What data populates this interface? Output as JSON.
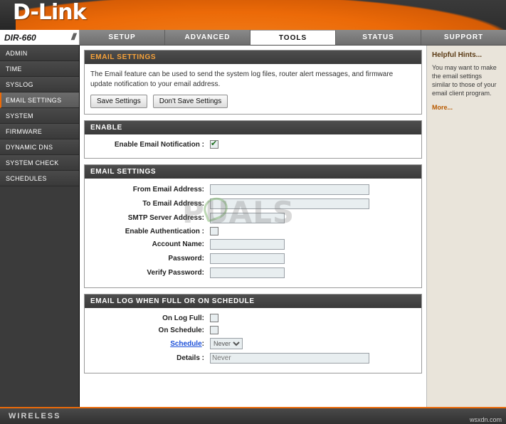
{
  "brand": {
    "logo": "D-Link",
    "footer": "WIRELESS",
    "credit": "wsxdn.com"
  },
  "nav": {
    "model": "DIR-660",
    "tabs": [
      {
        "label": "SETUP",
        "active": false
      },
      {
        "label": "ADVANCED",
        "active": false
      },
      {
        "label": "TOOLS",
        "active": true
      },
      {
        "label": "STATUS",
        "active": false
      },
      {
        "label": "SUPPORT",
        "active": false
      }
    ]
  },
  "sidebar": {
    "items": [
      {
        "label": "ADMIN",
        "active": false
      },
      {
        "label": "TIME",
        "active": false
      },
      {
        "label": "SYSLOG",
        "active": false
      },
      {
        "label": "EMAIL SETTINGS",
        "active": true
      },
      {
        "label": "SYSTEM",
        "active": false
      },
      {
        "label": "FIRMWARE",
        "active": false
      },
      {
        "label": "DYNAMIC DNS",
        "active": false
      },
      {
        "label": "SYSTEM CHECK",
        "active": false
      },
      {
        "label": "SCHEDULES",
        "active": false
      }
    ]
  },
  "main": {
    "intro_panel": {
      "title": "EMAIL SETTINGS",
      "description": "The Email feature can be used to send the system log files, router alert messages, and firmware update notification to your email address.",
      "save_label": "Save Settings",
      "dont_save_label": "Don't Save Settings"
    },
    "enable_panel": {
      "title": "ENABLE",
      "notification_label": "Enable Email Notification :",
      "notification_checked": true
    },
    "email_panel": {
      "title": "EMAIL SETTINGS",
      "from_label": "From Email Address:",
      "from_value": "",
      "to_label": "To Email Address:",
      "to_value": "",
      "smtp_label": "SMTP Server Address:",
      "smtp_value": "",
      "auth_label": "Enable Authentication :",
      "auth_checked": false,
      "account_label": "Account Name:",
      "account_value": "",
      "password_label": "Password:",
      "password_value": "",
      "verify_label": "Verify Password:",
      "verify_value": ""
    },
    "log_panel": {
      "title": "EMAIL LOG WHEN FULL OR ON SCHEDULE",
      "on_log_full_label": "On Log Full:",
      "on_log_full_checked": false,
      "on_schedule_label": "On Schedule:",
      "on_schedule_checked": false,
      "schedule_label": "Schedule",
      "schedule_colon": ":",
      "schedule_selected": "Never",
      "details_label": "Details :",
      "details_value": "Never"
    }
  },
  "hints": {
    "title": "Helpful Hints...",
    "body": "You may want to make the email settings similar to those of your email client program.",
    "more": "More..."
  },
  "watermark": {
    "text": "PUALS"
  }
}
